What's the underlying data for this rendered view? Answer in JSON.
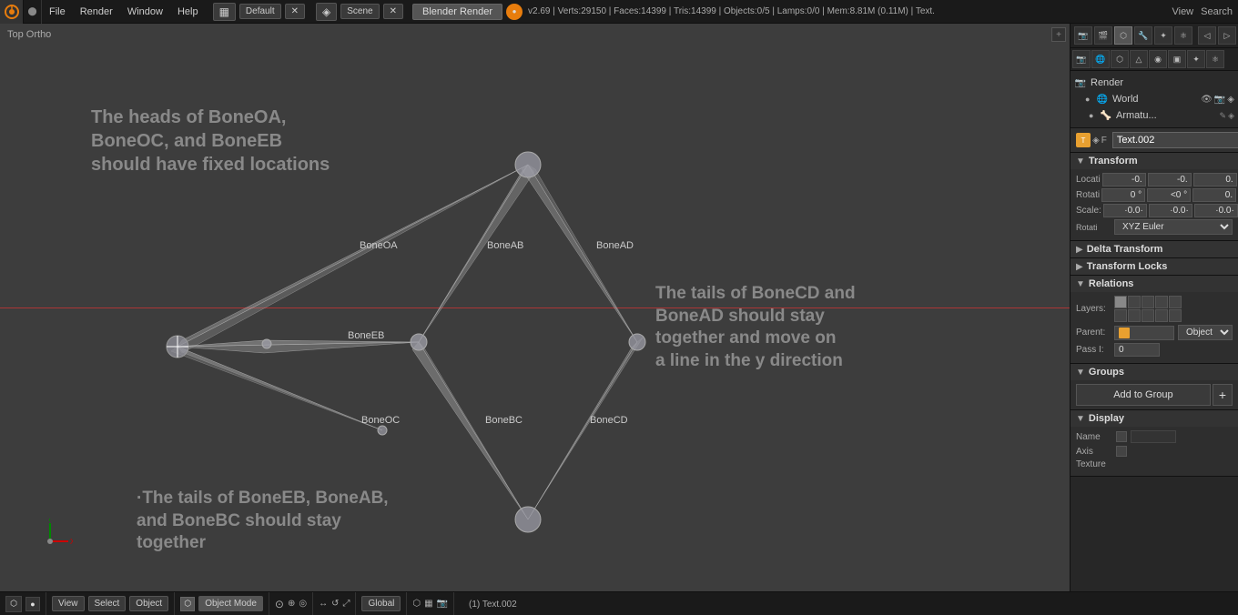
{
  "topbar": {
    "logo": "⬡",
    "menus": [
      "File",
      "Render",
      "Window",
      "Help"
    ],
    "workspace_label": "Default",
    "workspace_icon": "▦",
    "scene_label": "Scene",
    "render_engine": "Blender Render",
    "stats": "v2.69 | Verts:29150 | Faces:14399 | Tris:14399 | Objects:0/5 | Lamps:0/0 | Mem:8.81M (0.11M) | Text.",
    "view_label": "View",
    "search_label": "Search"
  },
  "viewport": {
    "label": "Top Ortho",
    "annotation1": "The heads of BoneOA,\nBoneOC, and BoneEB\nshould have fixed locations",
    "annotation2": "The tails of BoneCD and\nBoneAD should stay\ntogether and move on\na line in the y direction",
    "annotation3": "The tails of BoneEB, BoneAB,\nand BoneBC should stay\ntogether",
    "bone_labels": [
      "BoneOA",
      "BoneAB",
      "BoneAD",
      "BoneEB",
      "BoneBC",
      "BoneCD",
      "BoneOC"
    ]
  },
  "bottombar": {
    "view_btn": "View",
    "select_btn": "Select",
    "object_btn": "Object",
    "mode_btn": "Object Mode",
    "global_btn": "Global",
    "status": "(1) Text.002"
  },
  "props": {
    "title": "Text.002",
    "object_name": "Text.002",
    "scene_items": [
      {
        "label": "Render",
        "icon": "📷"
      },
      {
        "label": "World",
        "icon": "🌐"
      },
      {
        "label": "Armatu...",
        "icon": "🦴"
      }
    ],
    "search_label": "Search",
    "view_label": "View",
    "transform": {
      "title": "Transform",
      "location": [
        "-0.",
        "-0.",
        "0."
      ],
      "rotation": [
        "0 °",
        "<0 °",
        "0."
      ],
      "scale": [
        "·0.0·",
        "·0.0·",
        "·0.0·"
      ],
      "rot_mode": "XYZ Euler",
      "loc_label": "Locati",
      "rot_label": "Rotati",
      "scale_label": "Scale:"
    },
    "delta_transform": {
      "title": "Delta Transform",
      "collapsed": true
    },
    "transform_locks": {
      "title": "Transform Locks",
      "collapsed": true
    },
    "relations": {
      "title": "Relations",
      "layers_label": "Layers:",
      "parent_label": "Parent:",
      "parent_value": "",
      "parent_icon": "cube",
      "parent_type": "Object",
      "pass_label": "Pass I:",
      "pass_value": "0"
    },
    "groups": {
      "title": "Groups",
      "add_to_group": "Add to Group"
    },
    "display": {
      "title": "Display",
      "name_label": "Name",
      "axis_label": "Axis",
      "texture_label": "Texture"
    }
  }
}
